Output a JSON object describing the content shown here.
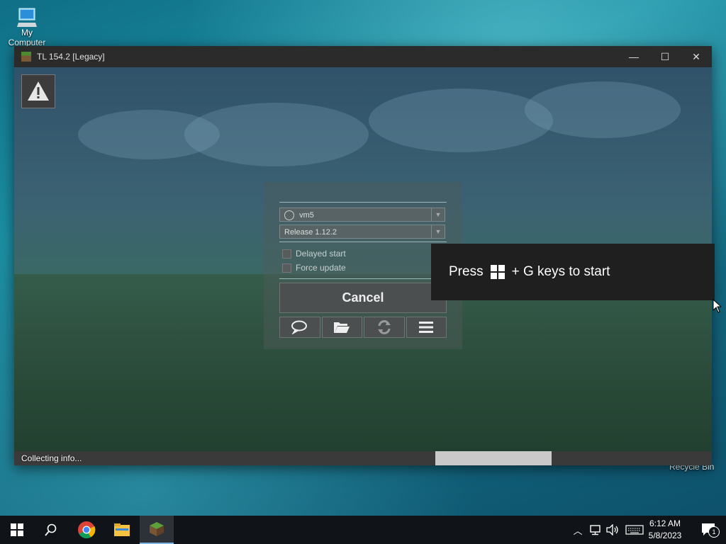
{
  "desktop": {
    "icons": [
      {
        "label": "My Computer"
      },
      {
        "label": "Recycle Bin"
      }
    ]
  },
  "window": {
    "title": "TL 154.2 [Legacy]",
    "controls": {
      "minimize": "—",
      "maximize": "☐",
      "close": "✕"
    }
  },
  "launcher": {
    "account": "vm5",
    "version": "Release 1.12.2",
    "options": [
      {
        "label": "Delayed start",
        "checked": false
      },
      {
        "label": "Force update",
        "checked": false
      }
    ],
    "cancel_label": "Cancel",
    "tools": [
      "chat-icon",
      "folder-icon",
      "refresh-icon",
      "menu-icon"
    ]
  },
  "status": {
    "text": "Collecting info..."
  },
  "toast": {
    "press": "Press",
    "keys": "+ G keys to start"
  },
  "taskbar": {
    "time": "6:12 AM",
    "date": "5/8/2023",
    "notifications": "1",
    "colors": {
      "taskbar": "#101418",
      "active_indicator": "#7fb5e5"
    }
  }
}
